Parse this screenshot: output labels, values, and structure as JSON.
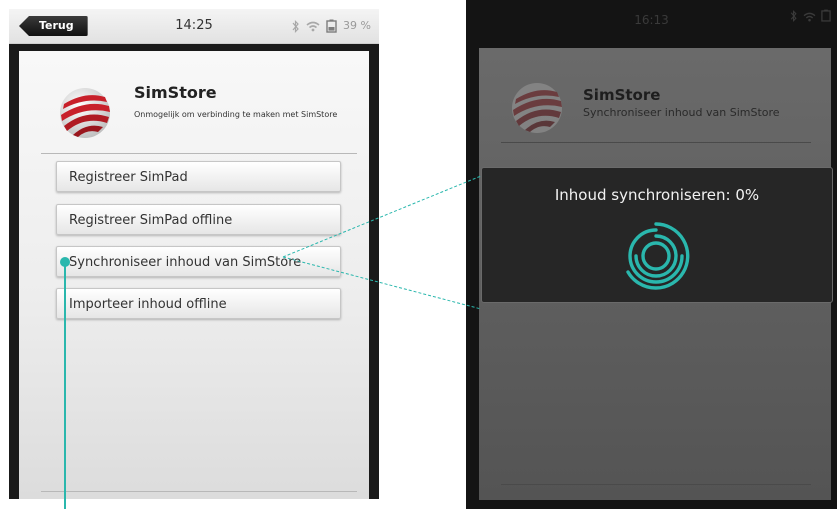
{
  "left_device": {
    "back_label": "Terug",
    "time": "14:25",
    "battery": "39 %",
    "app_title": "SimStore",
    "app_subtitle": "Onmogelijk om verbinding te maken met SimStore",
    "menu": [
      {
        "label": "Registreer SimPad"
      },
      {
        "label": "Registreer SimPad offline"
      },
      {
        "label": "Synchroniseer inhoud van SimStore"
      },
      {
        "label": "Importeer inhoud offline"
      }
    ]
  },
  "right_device": {
    "time": "16:13",
    "app_title": "SimStore",
    "app_subtitle": "Synchroniseer inhoud van SimStore",
    "dialog_title": "Inhoud synchroniseren: 0%",
    "progress_percent": 0
  },
  "colors": {
    "accent": "#2ab7ad",
    "logo_red": "#c8202a",
    "dialog_bg": "#262626"
  },
  "icons": {
    "bluetooth": "bluetooth-icon",
    "wifi": "wifi-icon",
    "battery": "battery-icon",
    "spinner": "loading-spinner-icon"
  }
}
